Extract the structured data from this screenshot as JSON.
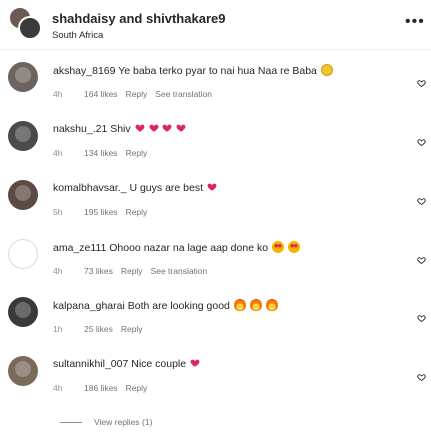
{
  "post": {
    "user_a": "shahdaisy",
    "joiner": "and",
    "user_b": "shivthakare9",
    "location": "South Africa",
    "more_icon": "ellipsis-icon"
  },
  "comments": [
    {
      "user": "akshay_8169",
      "text": "Ye baba terko pyar to nai hua Naa re Baba",
      "emoji": [
        "smile"
      ],
      "time": "4h",
      "likes": "164 likes",
      "reply": "Reply",
      "translate": "See translation"
    },
    {
      "user": "nakshu_.21",
      "text": "Shiv",
      "emoji": [
        "heart",
        "heart",
        "heart",
        "heart"
      ],
      "time": "4h",
      "likes": "134 likes",
      "reply": "Reply",
      "translate": ""
    },
    {
      "user": "komalbhavsar._",
      "text": "U guys are best",
      "emoji": [
        "heart"
      ],
      "time": "5h",
      "likes": "195 likes",
      "reply": "Reply",
      "translate": ""
    },
    {
      "user": "ama_ze111",
      "text": "Ohooo nazar na lage aap done ko",
      "emoji": [
        "heart-eyes",
        "heart-eyes"
      ],
      "time": "4h",
      "likes": "73 likes",
      "reply": "Reply",
      "translate": "See translation"
    },
    {
      "user": "kalpana_gharai",
      "text": "Both are looking good",
      "emoji": [
        "fire",
        "fire",
        "fire"
      ],
      "time": "1h",
      "likes": "25 likes",
      "reply": "Reply",
      "translate": ""
    },
    {
      "user": "sultannikhil_007",
      "text": "Nice couple",
      "emoji": [
        "heart"
      ],
      "time": "4h",
      "likes": "186 likes",
      "reply": "Reply",
      "translate": ""
    }
  ],
  "view_replies": "View replies (1)",
  "colors": {
    "text": "#262626",
    "meta": "#737373",
    "heart": "#e0245e",
    "divider": "#efefef"
  }
}
